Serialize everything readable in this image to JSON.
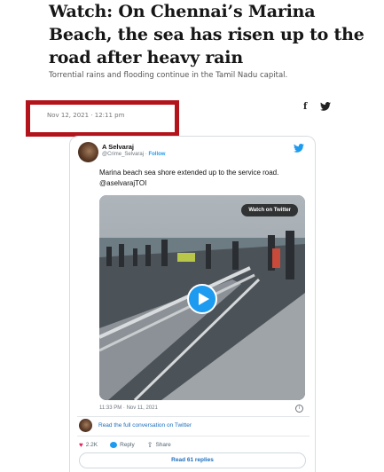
{
  "article": {
    "headline": "Watch: On Chennai’s Marina Beach, the sea has risen up to the road after heavy rain",
    "subhead": "Torrential rains and flooding continue in the Tamil Nadu capital.",
    "date": "Nov 12, 2021 · 12:11 pm",
    "share_facebook": "f"
  },
  "tweet": {
    "author_name": "A Selvaraj",
    "handle": "@Crime_Selvaraj",
    "handle_separator": " · ",
    "follow": "Follow",
    "text": "Marina beach sea shore extended up to the service road. @aselvarajTOI",
    "watch_label": "Watch on Twitter",
    "timestamp": "11:33 PM · Nov 11, 2021",
    "info": "i",
    "read_full": "Read the full conversation on Twitter",
    "likes": "2.2K",
    "reply": "Reply",
    "share": "Share",
    "replies_button": "Read 61 replies"
  },
  "colors": {
    "highlight_box": "#b3141b",
    "twitter_blue": "#1d9bf0",
    "like_red": "#e0245e"
  },
  "icons": [
    "facebook-icon",
    "twitter-bird-icon",
    "play-icon",
    "info-icon",
    "heart-icon",
    "reply-icon",
    "share-icon"
  ]
}
